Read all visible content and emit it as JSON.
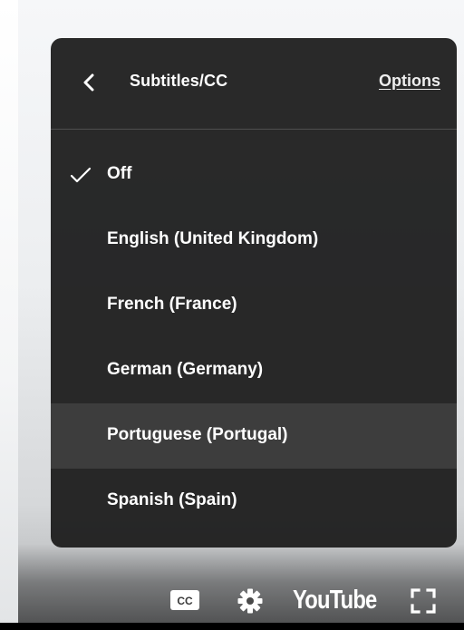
{
  "menu": {
    "title": "Subtitles/CC",
    "options_label": "Options",
    "items": [
      {
        "label": "Off",
        "selected": true
      },
      {
        "label": "English (United Kingdom)",
        "selected": false
      },
      {
        "label": "French (France)",
        "selected": false
      },
      {
        "label": "German (Germany)",
        "selected": false
      },
      {
        "label": "Portuguese (Portugal)",
        "selected": false,
        "highlighted": true
      },
      {
        "label": "Spanish (Spain)",
        "selected": false
      }
    ]
  },
  "controls": {
    "cc_label": "CC",
    "logo_text": "YouTube",
    "icons": [
      "cc-icon",
      "settings-gear-icon",
      "youtube-logo",
      "fullscreen-icon"
    ]
  },
  "colors": {
    "menu_background": "#1c1c1c",
    "text": "#ffffff",
    "highlight": "#3a3a3a"
  }
}
